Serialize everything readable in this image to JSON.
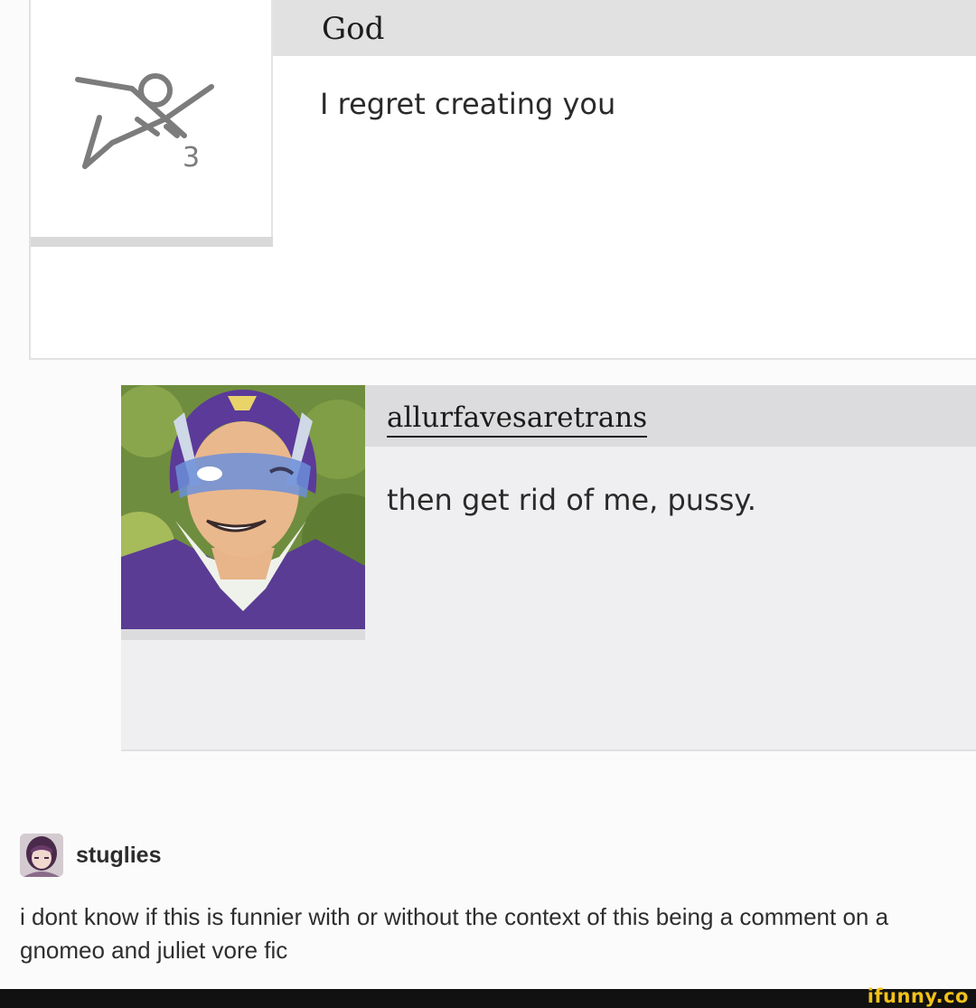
{
  "comments": [
    {
      "username": "God",
      "text": "I regret creating you",
      "avatar_icon": "scribble-logo-icon"
    },
    {
      "username": "allurfavesaretrans",
      "text": "then get rid of me, pussy.",
      "avatar_icon": "cartoon-hero-avatar-icon"
    }
  ],
  "reblog": {
    "username": "stuglies",
    "avatar_icon": "user-avatar-icon",
    "text": "i dont know if this is funnier with or without the context of this being a comment on a gnomeo and juliet vore fic"
  },
  "watermark": "ifunny.co",
  "colors": {
    "header_bar_1": "#e1e1e1",
    "header_bar_2": "#dcdcde",
    "watermark": "#f2c11a",
    "footer": "#111111"
  }
}
